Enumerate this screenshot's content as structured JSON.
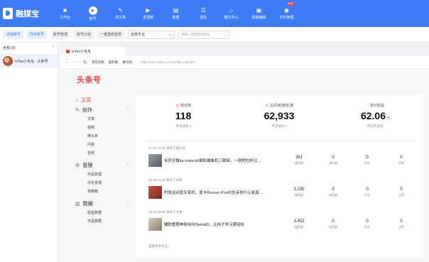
{
  "app": {
    "name": "融媒宝"
  },
  "nav": [
    {
      "label": "工作台",
      "icon": "■"
    },
    {
      "label": "账号",
      "icon": "●"
    },
    {
      "label": "发文章",
      "icon": "✎"
    },
    {
      "label": "发视频",
      "icon": "▶"
    },
    {
      "label": "数据",
      "icon": "▤"
    },
    {
      "label": "团队",
      "icon": "☰"
    },
    {
      "label": "爆文中心",
      "icon": "⌂"
    },
    {
      "label": "视频编辑",
      "icon": "▣"
    },
    {
      "label": "评论管理",
      "icon": "◉",
      "badge": "NEW"
    }
  ],
  "toolbar": {
    "add_account": "添加账号",
    "sync_account": "同步账号",
    "account_manage": "账号管理",
    "account_group": "账号分组",
    "relogin_all": "一键重新登录",
    "platform_select": "全部平台",
    "search_placeholder": "请输入要搜索的账号"
  },
  "account_panel": {
    "header": "全部 (0)",
    "account_name": "isYou小毛毛 - 头条号"
  },
  "browser": {
    "tab_title": "isYou小毛毛",
    "toolbar_links": [
      "领空间账",
      "面积图",
      "番纹图"
    ],
    "url": "https://mp.toutiao.com/profile_v4/index"
  },
  "toutiao": {
    "logo": "头条号",
    "menu": [
      {
        "label": "主页",
        "icon": "⌂",
        "sub": []
      },
      {
        "label": "创作",
        "icon": "✎",
        "sub": [
          "文章",
          "视频",
          "微头条",
          "问答",
          "音频"
        ]
      },
      {
        "label": "管理",
        "icon": "⚙",
        "sub": [
          "作品管理",
          "评论管理",
          "草稿箱"
        ]
      },
      {
        "label": "数据",
        "icon": "▥",
        "sub": [
          "收益数据",
          "作品数据"
        ]
      }
    ],
    "stats": [
      {
        "label": "粉丝数",
        "icon": "◷",
        "value": "118",
        "unit": "",
        "sub": "昨日涨粉 0"
      },
      {
        "label": "总阅读(播放)量",
        "icon": "◴",
        "value": "62,933",
        "unit": "",
        "sub": "昨日阅读 0"
      },
      {
        "label": "累计收益",
        "icon": "◔",
        "value": "62.06",
        "unit": "元",
        "sub": "昨日无变化"
      }
    ],
    "posts": [
      {
        "meta": "07-04 22:50  发布了图头条",
        "title": "米弥灵傲ka muta-bk摄影摄像机三脚架，一款把拉折比…",
        "views": "381",
        "views_label": "展现量",
        "reads": "0",
        "reads_label": "阅读量",
        "comments": "0",
        "comments_label": "评论",
        "likes": "0",
        "likes_label": "点赞"
      },
      {
        "meta": "06-29 11:36  发布了文章",
        "title": "时尚运动蓝牙耳机，南卡Runner Pro4S告诉你什么是真…",
        "views": "1,230",
        "views_label": "展现量",
        "reads": "0",
        "reads_label": "阅读量",
        "comments": "0",
        "comments_label": "评论",
        "likes": "0",
        "likes_label": "点赞"
      },
      {
        "meta": "06-18 09:08  发布了文章",
        "title": "辅助整理神奇咕咕TeenHD，让孩子学习更轻松",
        "views": "1,452",
        "views_label": "展现量",
        "reads": "0",
        "reads_label": "阅读量",
        "comments": "0",
        "comments_label": "评论",
        "likes": "0",
        "likes_label": "点赞"
      }
    ],
    "more_link": "查看更多作品 〉"
  }
}
